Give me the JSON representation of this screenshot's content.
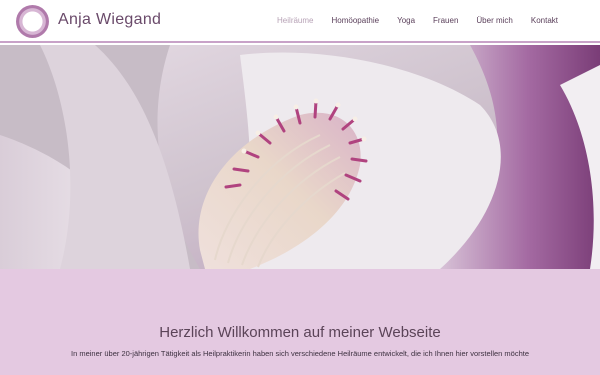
{
  "header": {
    "brand": "Anja Wiegand",
    "logo_icon": "ring-logo-icon",
    "nav": [
      {
        "label": "Heilräume",
        "active": true
      },
      {
        "label": "Homöopathie",
        "active": false
      },
      {
        "label": "Yoga",
        "active": false
      },
      {
        "label": "Frauen",
        "active": false
      },
      {
        "label": "Über mich",
        "active": false
      },
      {
        "label": "Kontakt",
        "active": false
      }
    ]
  },
  "hero": {
    "image": "magnolia-blossom-photo"
  },
  "welcome": {
    "title": "Herzlich Willkommen auf meiner Webseite",
    "text": "In meiner über 20-jährigen Tätigkeit als Heilpraktikerin haben sich verschiedene Heilräume entwickelt, die ich Ihnen hier vorstellen möchte"
  },
  "colors": {
    "accent": "#c8a2c8",
    "band": "#e4c9e1"
  }
}
